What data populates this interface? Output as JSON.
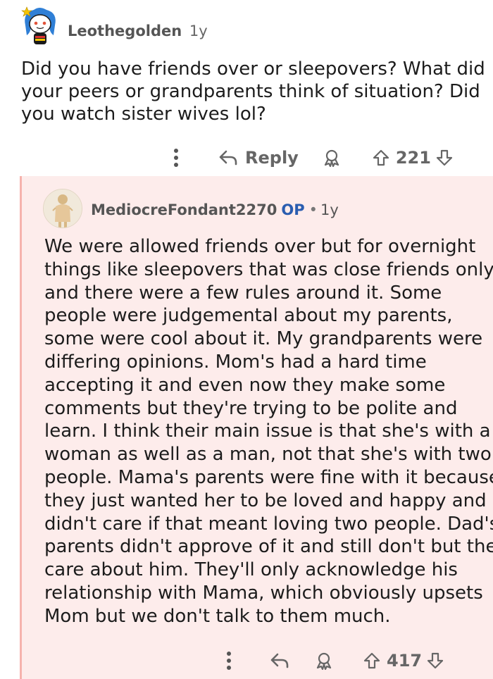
{
  "top_comment": {
    "author": "Leothegolden",
    "age": "1y",
    "body_lines": [
      "Did you have friends over or sleepovers? What did",
      "your peers or grandparents think of situation? Did",
      "you watch sister wives lol?"
    ],
    "reply_label": "Reply",
    "score": "221"
  },
  "reply_comment": {
    "author": "MediocreFondant2270",
    "op_badge": "OP",
    "separator": "•",
    "age": "1y",
    "body_lines": [
      "We were allowed friends over but for overnight",
      "things like sleepovers that was close friends only",
      "and there were a few rules around it. Some",
      "people were judgemental about my parents,",
      "some were cool about it. My grandparents were",
      "differing opinions. Mom's had a hard time",
      "accepting it and even now they make some",
      "comments but they're trying to be polite and",
      "learn. I think their main issue is that she's with a",
      "woman as well as a man, not that she's with two",
      "people. Mama's parents were fine with it because",
      "they just wanted her to be loved and happy and",
      "didn't care if that meant loving two people. Dad's",
      "parents didn't approve of it and still don't but they",
      "care about him. They'll only acknowledge his",
      "relationship with Mama, which obviously upsets",
      "Mom but we don't talk to them much."
    ],
    "score": "417"
  },
  "colors": {
    "reply_background": "#fdeceb",
    "thread_line": "#f6b3ad",
    "op_badge": "#2a5db0",
    "meta_text": "#555555"
  },
  "icons": {
    "more": "more-vertical-icon",
    "reply": "reply-arrow-icon",
    "award": "award-icon",
    "upvote": "upvote-arrow-icon",
    "downvote": "downvote-arrow-icon"
  }
}
